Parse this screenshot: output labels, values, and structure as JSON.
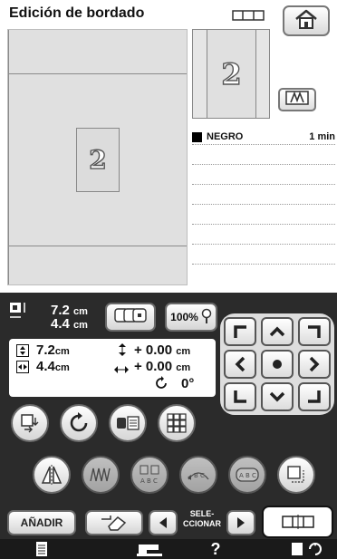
{
  "header": {
    "title": "Edición de bordado"
  },
  "design": {
    "glyph": "2"
  },
  "threads": {
    "color_name": "NEGRO",
    "time": "1 min"
  },
  "size": {
    "width_value": "7.2",
    "height_value": "4.4",
    "unit": "cm"
  },
  "zoom": {
    "label": "100%"
  },
  "info": {
    "height_value": "7.2",
    "width_value": "4.4",
    "unit": "cm",
    "offset_v": "+ 0.00",
    "offset_h": "+ 0.00",
    "rotation": "0°"
  },
  "bottom": {
    "add_label": "AÑADIR",
    "select_label_line1": "SELE-",
    "select_label_line2": "CCIONAR",
    "help_label": "?"
  },
  "colors": {
    "panel": "#2b2b2b",
    "canvas": "#e0e0e0",
    "button_border": "#6a6a6a"
  }
}
